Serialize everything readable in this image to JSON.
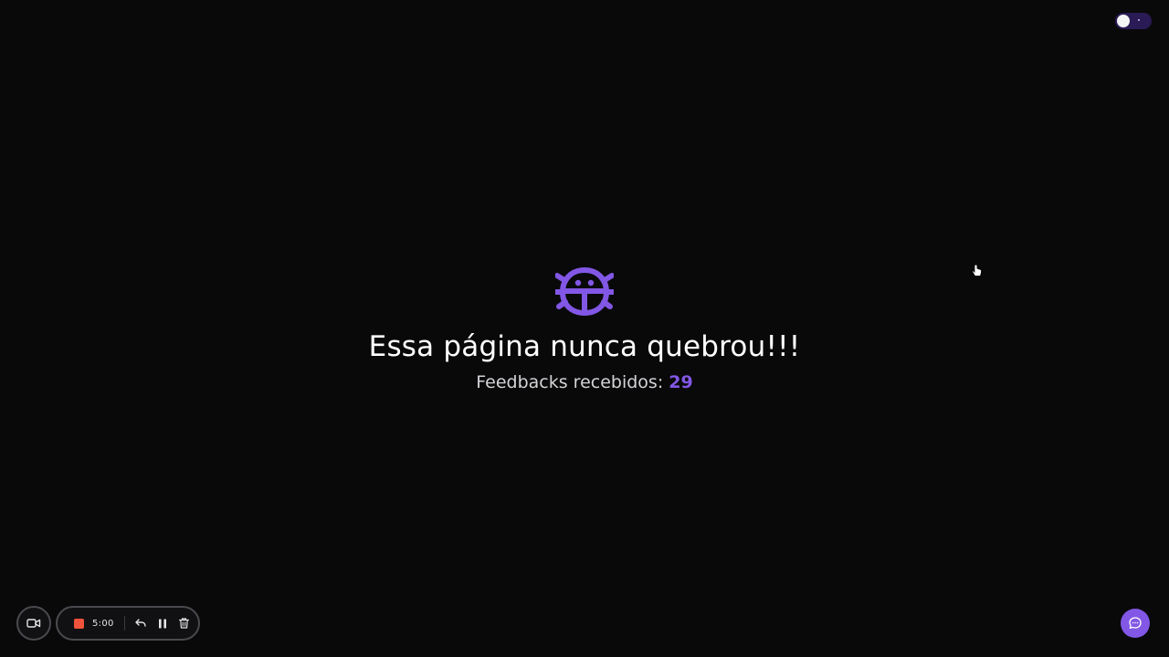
{
  "theme_toggle": {
    "state": "dark"
  },
  "hero": {
    "icon": "bug-icon",
    "title": "Essa página nunca quebrou!!!",
    "subtitle_label": "Feedbacks recebidos:",
    "feedback_count": "29"
  },
  "recorder": {
    "camera_icon": "video-camera-icon",
    "stop_icon": "stop-icon",
    "timer": "5:00",
    "undo_icon": "undo-icon",
    "pause_icon": "pause-icon",
    "delete_icon": "trash-icon"
  },
  "chat": {
    "icon": "chat-bubble-icon"
  },
  "colors": {
    "background": "#09090a",
    "accent": "#8257e5",
    "record": "#f0533b",
    "text": "#ffffff",
    "muted_text": "#d4d4d8"
  }
}
